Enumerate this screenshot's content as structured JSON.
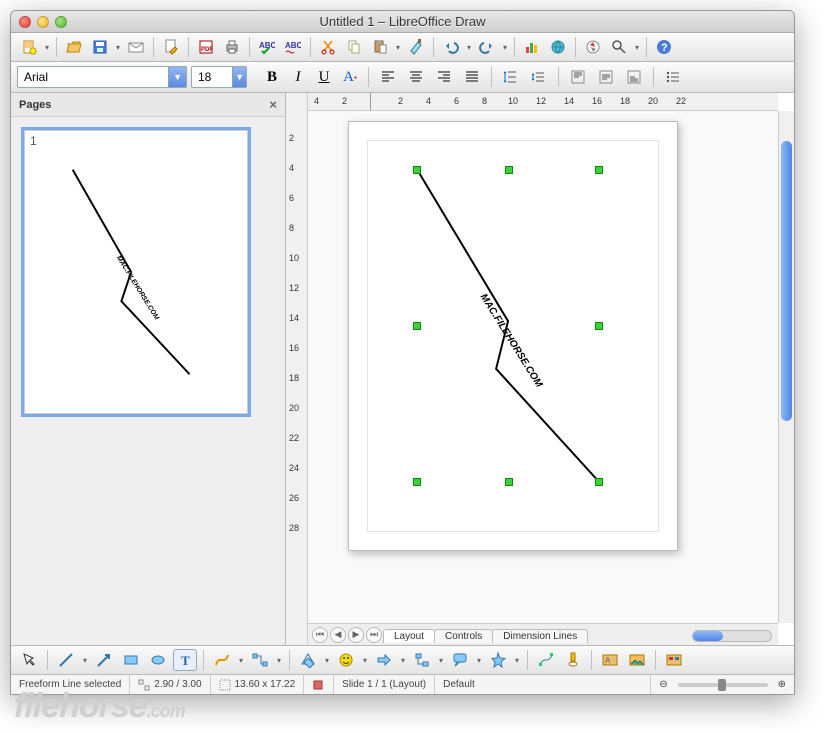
{
  "window": {
    "title": "Untitled 1 – LibreOffice Draw"
  },
  "font": {
    "name": "Arial",
    "size": "18"
  },
  "pages_panel": {
    "title": "Pages",
    "thumb_number": "1"
  },
  "watermark_text": "MAC.FILEHORSE.COM",
  "tabs": {
    "layout": "Layout",
    "controls": "Controls",
    "dimension": "Dimension Lines"
  },
  "hruler_marks": [
    "4",
    "2",
    "",
    "2",
    "4",
    "6",
    "8",
    "10",
    "12",
    "14",
    "16",
    "18",
    "20",
    "22"
  ],
  "vruler_marks": [
    "",
    "2",
    "4",
    "6",
    "8",
    "10",
    "12",
    "14",
    "16",
    "18",
    "20",
    "22",
    "24",
    "26",
    "28"
  ],
  "status": {
    "selection": "Freeform Line selected",
    "pos": "2.90 / 3.00",
    "size": "13.60 x 17.22",
    "slide": "Slide 1 / 1 (Layout)",
    "default": "Default"
  },
  "watermark_brand": "filehorse",
  "watermark_tld": ".com"
}
